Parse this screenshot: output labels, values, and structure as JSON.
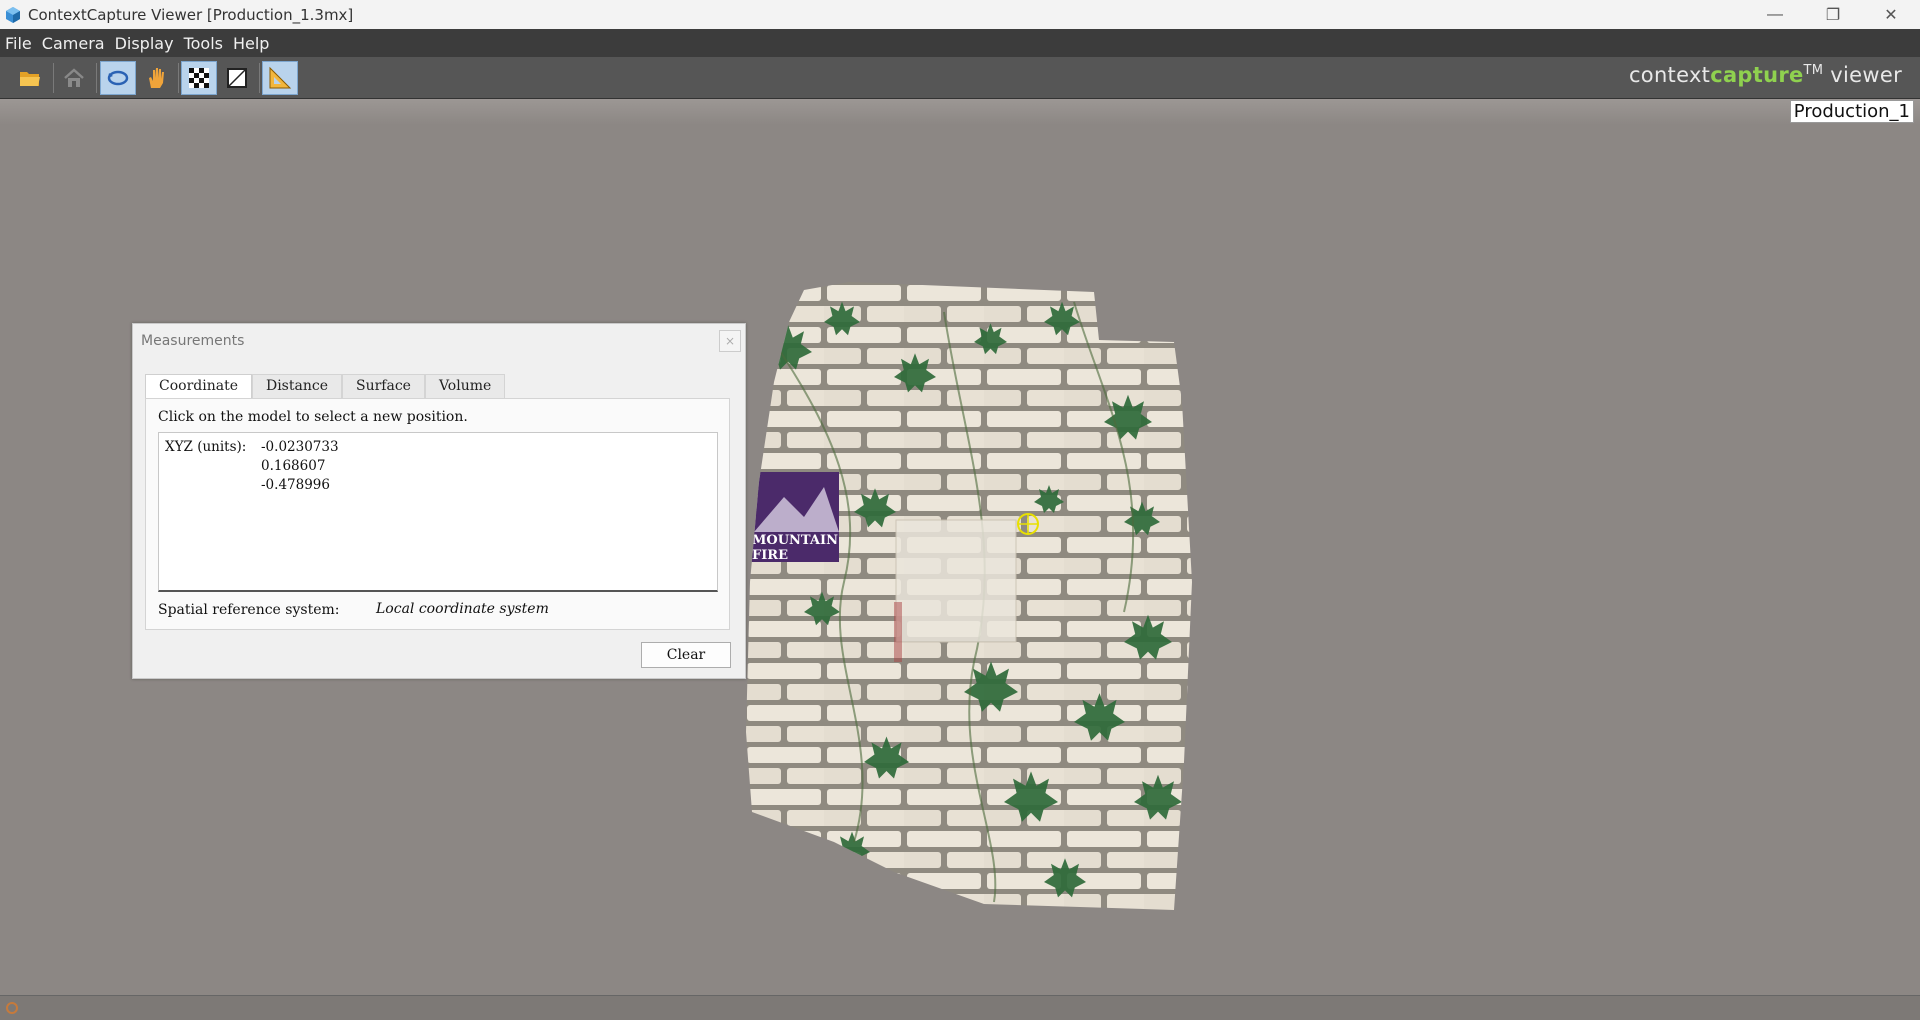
{
  "window": {
    "title": "ContextCapture Viewer [Production_1.3mx]",
    "app_icon": "cube-icon",
    "controls": [
      "minimize-icon",
      "restore-icon",
      "close-icon"
    ]
  },
  "menu": {
    "items": [
      "File",
      "Camera",
      "Display",
      "Tools",
      "Help"
    ]
  },
  "toolbar": {
    "buttons": [
      {
        "icon": "open-folder-icon",
        "active": false
      },
      {
        "icon": "home-icon",
        "active": false
      },
      {
        "icon": "orbit-icon",
        "active": true
      },
      {
        "icon": "pan-hand-icon",
        "active": false
      },
      {
        "icon": "texture-checker-icon",
        "active": true
      },
      {
        "icon": "wireframe-icon",
        "active": false
      },
      {
        "icon": "measure-ruler-icon",
        "active": true
      }
    ],
    "brand_context": "context",
    "brand_capture": "capture",
    "brand_tm": "TM",
    "brand_viewer": " viewer"
  },
  "viewport": {
    "production_label": "Production_1",
    "model_poster_lines": [
      "MOUNTAIN",
      "FIRE"
    ]
  },
  "measurements": {
    "title": "Measurements",
    "close": "×",
    "tabs": [
      "Coordinate",
      "Distance",
      "Surface",
      "Volume"
    ],
    "active_tab": "Coordinate",
    "instruction": "Click on the model to select a new position.",
    "xyz_label": "XYZ (units):",
    "x": "-0.0230733",
    "y": "0.168607",
    "z": "-0.478996",
    "srs_label": "Spatial reference system:",
    "srs_value": "Local coordinate system",
    "clear_label": "Clear"
  },
  "colors": {
    "brand_green": "#8fd14f",
    "viewport_bg": "#8c8784",
    "menubar_bg": "#3c3c3c",
    "toolbar_bg": "#565656"
  }
}
